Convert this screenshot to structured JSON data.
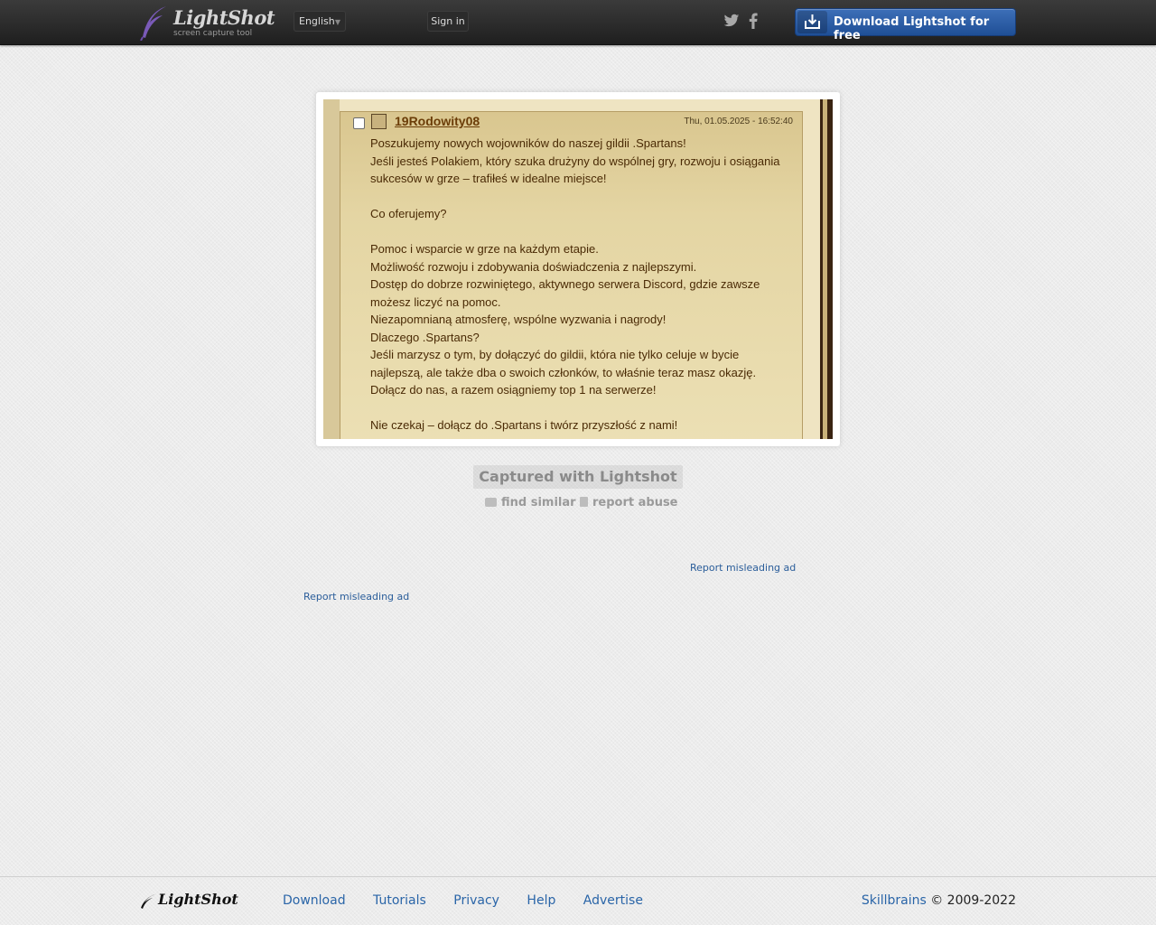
{
  "header": {
    "logo_title": "LightShot",
    "logo_subtitle": "screen capture tool",
    "language": "English",
    "sign_in": "Sign in",
    "download_button": "Download Lightshot for free",
    "social_icons": [
      "twitter-icon",
      "facebook-icon"
    ]
  },
  "screenshot": {
    "author": "19Rodowity08",
    "date": "Thu, 01.05.2025 - 16:52:40",
    "lines": [
      "Poszukujemy nowych wojowników do naszej gildii .Spartans!",
      "Jeśli jesteś Polakiem, który szuka drużyny do wspólnej gry, rozwoju i osiągania",
      "sukcesów w grze – trafiłeś w idealne miejsce!",
      "",
      "Co oferujemy?",
      "",
      "Pomoc i wsparcie w grze na każdym etapie.",
      "Możliwość rozwoju i zdobywania doświadczenia z najlepszymi.",
      "Dostęp do dobrze rozwiniętego, aktywnego serwera Discord, gdzie zawsze",
      "możesz liczyć na pomoc.",
      "Niezapomnianą atmosferę, wspólne wyzwania i nagrody!",
      "Dlaczego .Spartans?",
      "Jeśli marzysz o tym, by dołączyć do gildii, która nie tylko celuje w bycie",
      "najlepszą, ale także dba o swoich członków, to właśnie teraz masz okazję.",
      "Dołącz do nas, a razem osiągniemy top 1 na serwerze!",
      "",
      "Nie czekaj – dołącz do .Spartans i twórz przyszłość z nami!"
    ]
  },
  "caption": "Captured with Lightshot",
  "actions": {
    "find_similar": "find similar",
    "report_abuse": "report abuse"
  },
  "ads": {
    "report_1": "Report misleading ad",
    "report_2": "Report misleading ad"
  },
  "footer": {
    "logo": "LightShot",
    "nav": [
      "Download",
      "Tutorials",
      "Privacy",
      "Help",
      "Advertise"
    ],
    "company": "Skillbrains",
    "copyright": "© 2009-2022"
  },
  "colors": {
    "header_bg": "#2a2a2a",
    "download_button": "#2a5ea8",
    "link": "#2a65a8"
  }
}
